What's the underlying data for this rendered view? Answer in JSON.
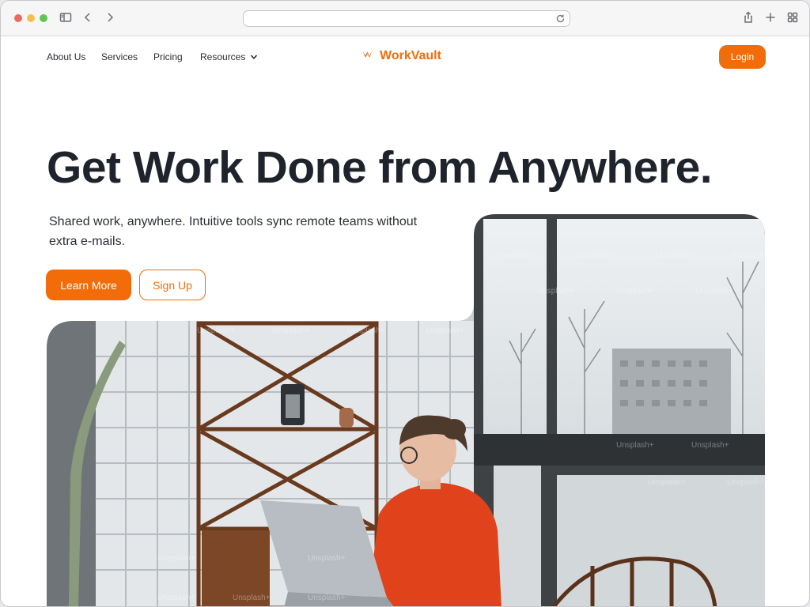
{
  "browser": {
    "url": ""
  },
  "nav": {
    "about": "About Us",
    "services": "Services",
    "pricing": "Pricing",
    "resources": "Resources",
    "login": "Login"
  },
  "brand": {
    "name": "WorkVault",
    "color": "#f26d0a"
  },
  "hero": {
    "title": "Get Work Done from Anywhere.",
    "subtitle": "Shared work, anywhere. Intuitive tools sync remote teams without extra e-mails.",
    "learn_more": "Learn More",
    "sign_up": "Sign Up",
    "image_watermark": "Unsplash+"
  },
  "icons": {
    "sidebar": "sidebar-icon",
    "back": "chevron-left-icon",
    "forward": "chevron-right-icon",
    "reload": "reload-icon",
    "share": "share-icon",
    "new_tab": "plus-icon",
    "tabs": "grid-icon",
    "dropdown": "chevron-down-icon",
    "logo": "workvault-logo-icon"
  },
  "colors": {
    "accent": "#f26d0a",
    "text": "#1f232b"
  }
}
